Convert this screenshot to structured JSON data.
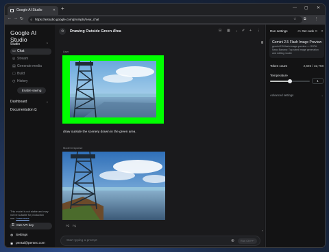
{
  "browser": {
    "tab_title": "Google AI Studio",
    "url": "https://aistudio.google.com/prompts/new_chat"
  },
  "sidebar": {
    "brand": "Google AI Studio",
    "studio_label": "Studio",
    "items": [
      {
        "label": "Chat",
        "icon": "chat-icon",
        "active": true
      },
      {
        "label": "Stream",
        "icon": "stream-icon",
        "active": false
      },
      {
        "label": "Generate media",
        "icon": "media-icon",
        "active": false
      },
      {
        "label": "Build",
        "icon": "build-icon",
        "active": false
      },
      {
        "label": "History",
        "icon": "history-icon",
        "active": false
      }
    ],
    "enable_saving": "Enable saving",
    "dashboard": "Dashboard",
    "documentation": "Documentation",
    "notice": "This model is not stable and may not be suitable for production use.",
    "learn_more": "Learn more",
    "get_api_key": "Get API key",
    "settings": "Settings",
    "user_email": "pentai@pentec.com"
  },
  "main": {
    "prompt_title": "Drawing Outside Green Area",
    "user_label": "User",
    "user_prompt": "draw outside the scenery drawn in the green area.",
    "model_label": "Model response",
    "input_placeholder": "Start typing a prompt",
    "run_label": "Run Ctrl+↵"
  },
  "right_panel": {
    "title": "Run settings",
    "get_code": "Get code",
    "model_name": "Gemini 2.5 Flash Image Preview",
    "model_desc": "gemini-2.5-flash-image-preview — SOTA Nano Banana: Top-rated image generation and editing model.",
    "token_label": "Token count",
    "token_value": "2,593 / 32,768",
    "temperature_label": "Temperature",
    "temperature_value": "1",
    "temperature_fraction": 0.5,
    "advanced_label": "Advanced settings"
  },
  "colors": {
    "accent_green": "#00ff00",
    "link": "#8ab4f8"
  }
}
